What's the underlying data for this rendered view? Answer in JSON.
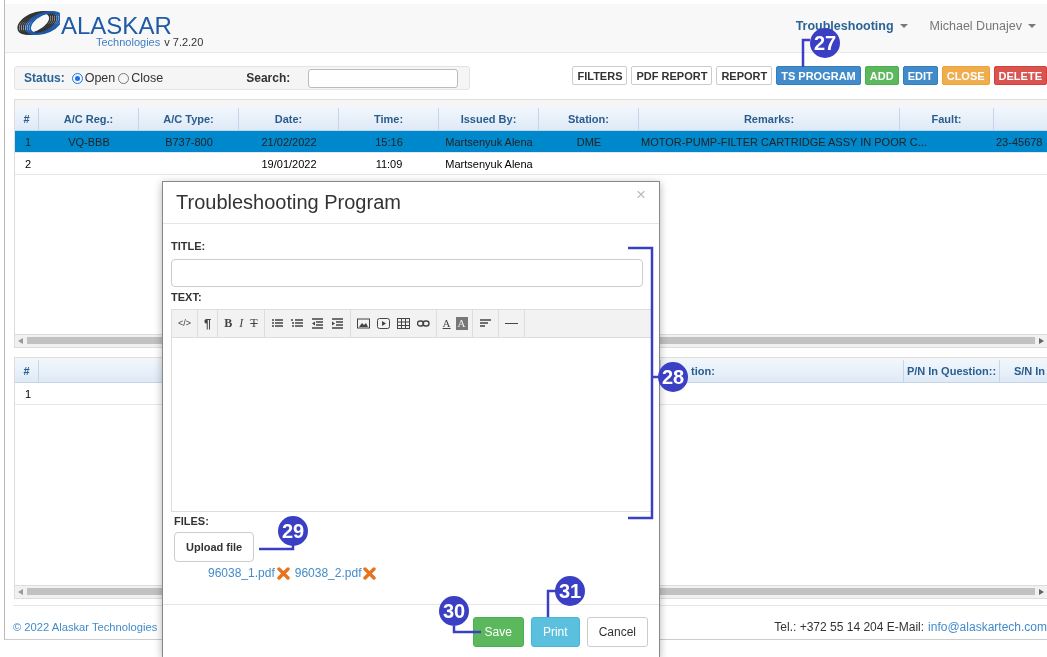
{
  "header": {
    "brand": "ALASKAR",
    "brand_sub": "Technologies",
    "version": "v 7.2.20",
    "nav": [
      {
        "label": "Troubleshooting",
        "selected": true
      },
      {
        "label": "Michael Dunajev",
        "selected": false
      }
    ]
  },
  "filter_bar": {
    "status_label": "Status:",
    "options": [
      {
        "label": "Open",
        "selected": true
      },
      {
        "label": "Close",
        "selected": false
      }
    ],
    "search_label": "Search:"
  },
  "actions": [
    {
      "label": "FILTERS",
      "kind": "plain"
    },
    {
      "label": "PDF REPORT",
      "kind": "plain"
    },
    {
      "label": "REPORT",
      "kind": "plain"
    },
    {
      "label": "TS PROGRAM",
      "kind": "primary"
    },
    {
      "label": "ADD",
      "kind": "success"
    },
    {
      "label": "EDIT",
      "kind": "primary"
    },
    {
      "label": "CLOSE",
      "kind": "warning"
    },
    {
      "label": "DELETE",
      "kind": "danger"
    }
  ],
  "table": {
    "columns": [
      "#",
      "A/C Reg.:",
      "A/C Type:",
      "Date:",
      "Time:",
      "Issued By:",
      "Station:",
      "Remarks:",
      "Fault:",
      ""
    ],
    "rows": [
      {
        "selected": true,
        "cells": [
          "1",
          "VQ-BBB",
          "B737-800",
          "21/02/2022",
          "15:16",
          "Martsenyuk Alena",
          "DME",
          "MOTOR-PUMP-FILTER CARTRIDGE ASSY IN POOR C...",
          "",
          "23-45678"
        ]
      },
      {
        "selected": false,
        "cells": [
          "2",
          "",
          "",
          "19/01/2022",
          "11:09",
          "Martsenyuk Alena",
          "",
          "",
          "",
          ""
        ]
      }
    ]
  },
  "table_2": {
    "columns": [
      "#",
      "",
      "tion:",
      "P/N In Question::",
      "S/N In"
    ],
    "rows": [
      {
        "selected": false,
        "cells": [
          "1",
          "",
          "",
          "",
          ""
        ]
      }
    ]
  },
  "footer": {
    "copyright": "© 2022 Alaskar Technologies",
    "contact": "Tel.: +372 55 14 204 E-Mail:",
    "email": "info@alaskartech.com"
  },
  "dialog": {
    "title": "Troubleshooting Program",
    "close": "×",
    "title_label": "TITLE:",
    "text_label": "TEXT:",
    "files_label": "FILES:",
    "upload": "Upload file",
    "toolbar": [
      [
        {
          "kind": "code",
          "label": "</>"
        }
      ],
      [
        {
          "kind": "paragraph",
          "label": "¶"
        }
      ],
      [
        {
          "kind": "bold",
          "label": "B"
        },
        {
          "kind": "italic",
          "label": "I"
        },
        {
          "kind": "strike",
          "label": "T"
        }
      ],
      [
        {
          "kind": "ul"
        },
        {
          "kind": "ol"
        },
        {
          "kind": "outdent"
        },
        {
          "kind": "indent"
        }
      ],
      [
        {
          "kind": "image"
        },
        {
          "kind": "video"
        },
        {
          "kind": "table"
        },
        {
          "kind": "link"
        }
      ],
      [
        {
          "kind": "fontcolor",
          "label": "A"
        },
        {
          "kind": "bgcolor",
          "label": "A"
        }
      ],
      [
        {
          "kind": "align"
        }
      ],
      [
        {
          "kind": "hr"
        }
      ]
    ],
    "files": [
      "96038_1.pdf",
      "96038_2.pdf"
    ],
    "buttons": [
      {
        "label": "Save",
        "kind": "success"
      },
      {
        "label": "Print",
        "kind": "info"
      },
      {
        "label": "Cancel",
        "kind": "plain"
      }
    ]
  },
  "callouts": [
    "27",
    "28",
    "29",
    "30",
    "31"
  ]
}
